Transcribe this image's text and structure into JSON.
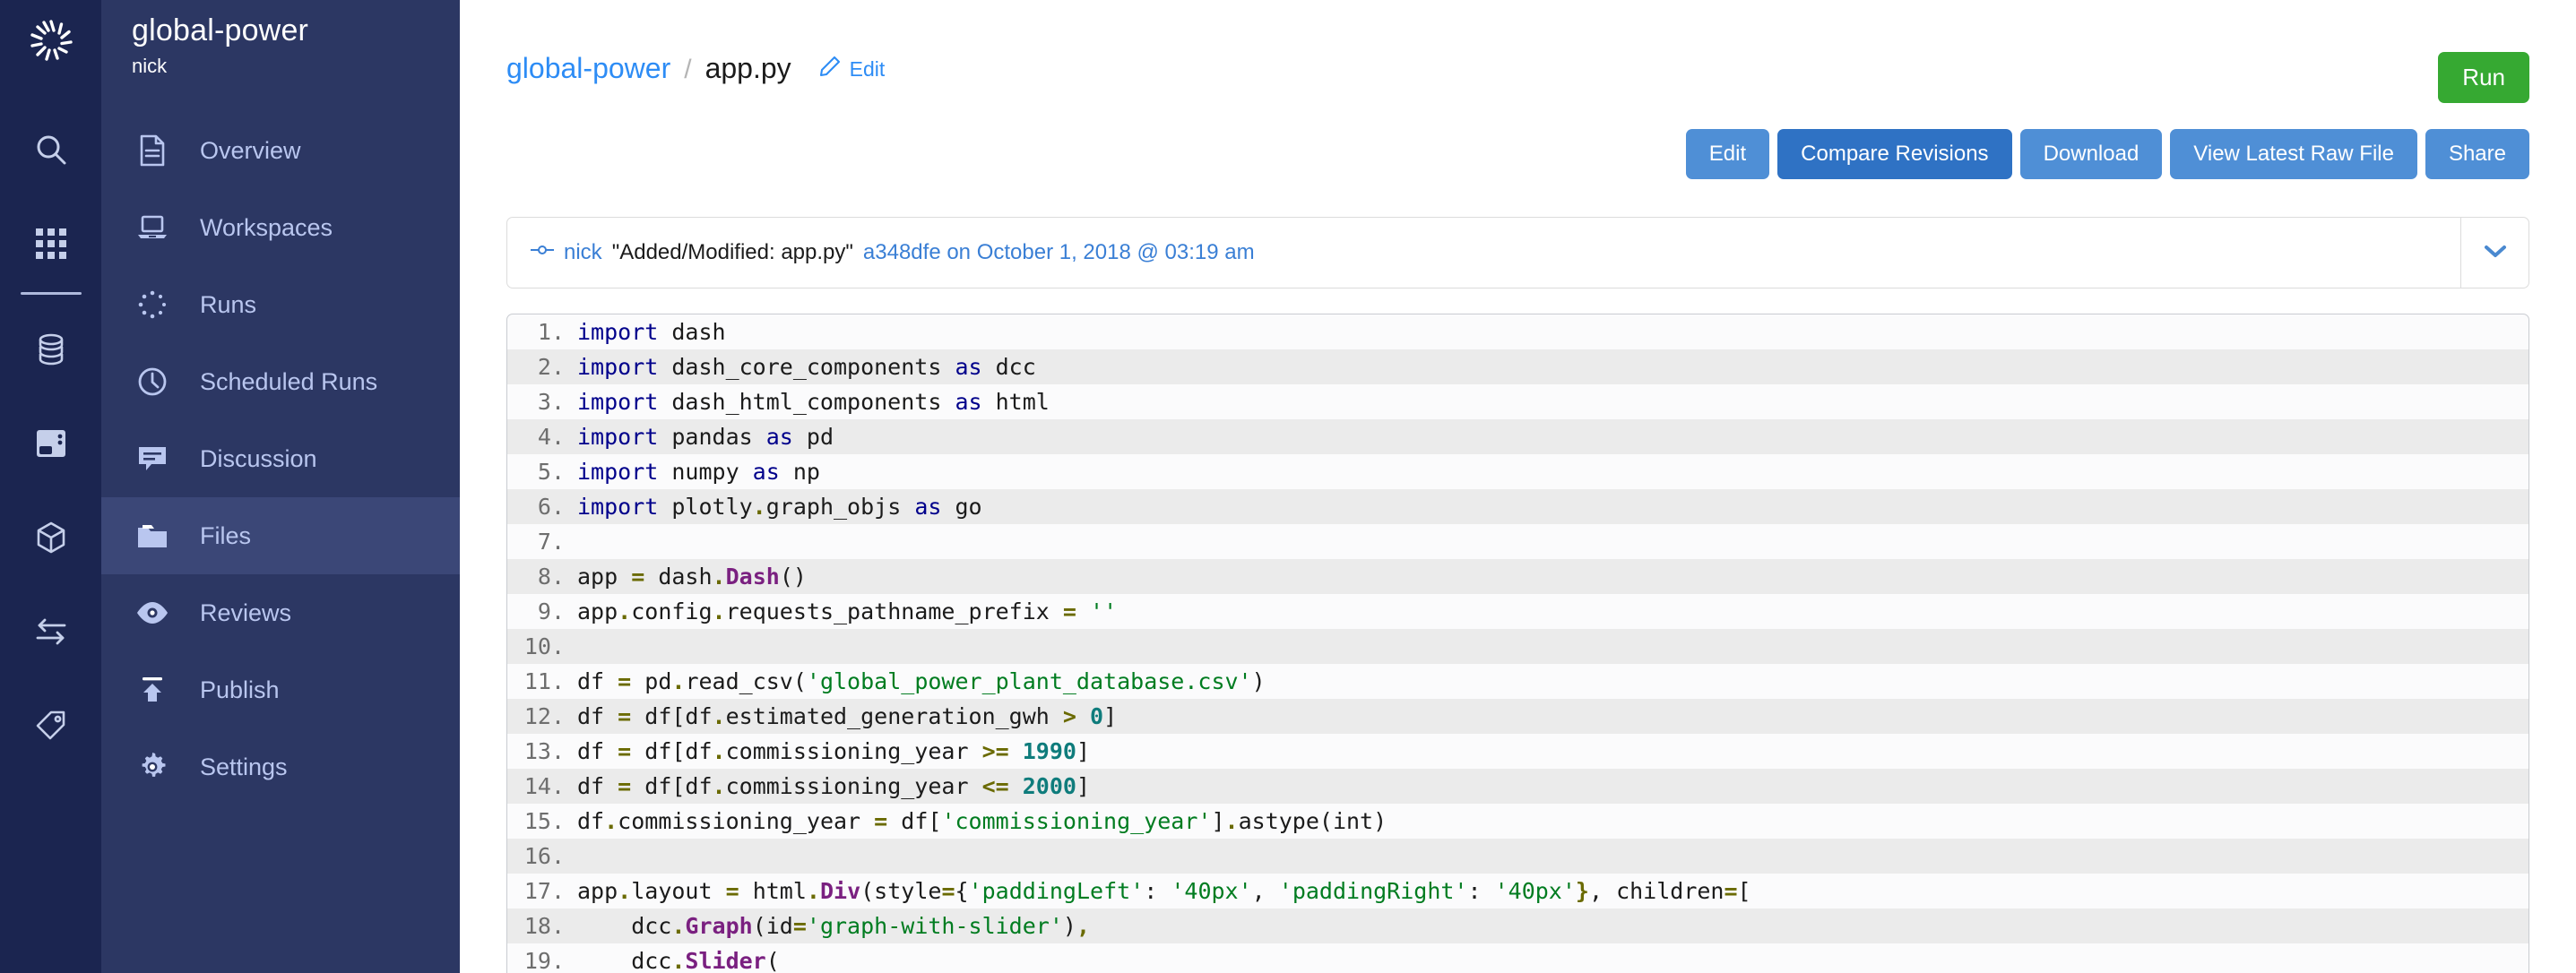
{
  "rail": {
    "logo_icon": "aperture-logo-icon",
    "icons": [
      {
        "name": "search-icon"
      },
      {
        "name": "apps-grid-icon"
      },
      {
        "name": "database-icon"
      },
      {
        "name": "server-icon"
      },
      {
        "name": "box-icon"
      },
      {
        "name": "transfer-arrows-icon"
      },
      {
        "name": "tag-icon"
      }
    ]
  },
  "sidebar": {
    "project": "global-power",
    "owner": "nick",
    "items": [
      {
        "label": "Overview",
        "icon": "document-icon",
        "active": false
      },
      {
        "label": "Workspaces",
        "icon": "laptop-icon",
        "active": false
      },
      {
        "label": "Runs",
        "icon": "spinner-dots-icon",
        "active": false
      },
      {
        "label": "Scheduled Runs",
        "icon": "clock-icon",
        "active": false
      },
      {
        "label": "Discussion",
        "icon": "comment-icon",
        "active": false
      },
      {
        "label": "Files",
        "icon": "folder-icon",
        "active": true
      },
      {
        "label": "Reviews",
        "icon": "eye-icon",
        "active": false
      },
      {
        "label": "Publish",
        "icon": "upload-arrow-icon",
        "active": false
      },
      {
        "label": "Settings",
        "icon": "gear-icon",
        "active": false
      }
    ]
  },
  "header": {
    "breadcrumb_root": "global-power",
    "breadcrumb_separator": "/",
    "breadcrumb_current": "app.py",
    "edit_label": "Edit",
    "edit_icon": "pencil-icon",
    "run_label": "Run"
  },
  "actions": [
    {
      "label": "Edit",
      "primary": false
    },
    {
      "label": "Compare Revisions",
      "primary": true
    },
    {
      "label": "Download",
      "primary": false
    },
    {
      "label": "View Latest Raw File",
      "primary": false
    },
    {
      "label": "Share",
      "primary": false
    }
  ],
  "commit": {
    "icon": "commit-node-icon",
    "user": "nick",
    "message": "\"Added/Modified: app.py\"",
    "hash_and_date": "a348dfe on October 1, 2018 @ 03:19 am",
    "caret_icon": "chevron-down-icon"
  },
  "code": {
    "language": "python",
    "lines": [
      {
        "n": "1.",
        "tokens": [
          [
            "kn",
            "import"
          ],
          [
            "p",
            " dash"
          ]
        ]
      },
      {
        "n": "2.",
        "tokens": [
          [
            "kn",
            "import"
          ],
          [
            "p",
            " dash_core_components "
          ],
          [
            "kn",
            "as"
          ],
          [
            "p",
            " dcc"
          ]
        ]
      },
      {
        "n": "3.",
        "tokens": [
          [
            "kn",
            "import"
          ],
          [
            "p",
            " dash_html_components "
          ],
          [
            "kn",
            "as"
          ],
          [
            "p",
            " html"
          ]
        ]
      },
      {
        "n": "4.",
        "tokens": [
          [
            "kn",
            "import"
          ],
          [
            "p",
            " pandas "
          ],
          [
            "kn",
            "as"
          ],
          [
            "p",
            " pd"
          ]
        ]
      },
      {
        "n": "5.",
        "tokens": [
          [
            "kn",
            "import"
          ],
          [
            "p",
            " numpy "
          ],
          [
            "kn",
            "as"
          ],
          [
            "p",
            " np"
          ]
        ]
      },
      {
        "n": "6.",
        "tokens": [
          [
            "kn",
            "import"
          ],
          [
            "p",
            " plotly"
          ],
          [
            "o",
            "."
          ],
          [
            "p",
            "graph_objs "
          ],
          [
            "kn",
            "as"
          ],
          [
            "p",
            " go"
          ]
        ]
      },
      {
        "n": "7.",
        "tokens": []
      },
      {
        "n": "8.",
        "tokens": [
          [
            "p",
            "app "
          ],
          [
            "o",
            "="
          ],
          [
            "p",
            " dash"
          ],
          [
            "o",
            "."
          ],
          [
            "cl",
            "Dash"
          ],
          [
            "p",
            "()"
          ]
        ]
      },
      {
        "n": "9.",
        "tokens": [
          [
            "p",
            "app"
          ],
          [
            "o",
            "."
          ],
          [
            "p",
            "config"
          ],
          [
            "o",
            "."
          ],
          [
            "p",
            "requests_pathname_prefix "
          ],
          [
            "o",
            "="
          ],
          [
            "p",
            " "
          ],
          [
            "s",
            "''"
          ]
        ]
      },
      {
        "n": "10.",
        "tokens": []
      },
      {
        "n": "11.",
        "tokens": [
          [
            "p",
            "df "
          ],
          [
            "o",
            "="
          ],
          [
            "p",
            " pd"
          ],
          [
            "o",
            "."
          ],
          [
            "p",
            "read_csv("
          ],
          [
            "s",
            "'global_power_plant_database.csv'"
          ],
          [
            "p",
            ")"
          ]
        ]
      },
      {
        "n": "12.",
        "tokens": [
          [
            "p",
            "df "
          ],
          [
            "o",
            "="
          ],
          [
            "p",
            " df[df"
          ],
          [
            "o",
            "."
          ],
          [
            "p",
            "estimated_generation_gwh "
          ],
          [
            "o",
            ">"
          ],
          [
            "p",
            " "
          ],
          [
            "n",
            "0"
          ],
          [
            "p",
            "]"
          ]
        ]
      },
      {
        "n": "13.",
        "tokens": [
          [
            "p",
            "df "
          ],
          [
            "o",
            "="
          ],
          [
            "p",
            " df[df"
          ],
          [
            "o",
            "."
          ],
          [
            "p",
            "commissioning_year "
          ],
          [
            "o",
            ">="
          ],
          [
            "p",
            " "
          ],
          [
            "n",
            "1990"
          ],
          [
            "p",
            "]"
          ]
        ]
      },
      {
        "n": "14.",
        "tokens": [
          [
            "p",
            "df "
          ],
          [
            "o",
            "="
          ],
          [
            "p",
            " df[df"
          ],
          [
            "o",
            "."
          ],
          [
            "p",
            "commissioning_year "
          ],
          [
            "o",
            "<="
          ],
          [
            "p",
            " "
          ],
          [
            "n",
            "2000"
          ],
          [
            "p",
            "]"
          ]
        ]
      },
      {
        "n": "15.",
        "tokens": [
          [
            "p",
            "df"
          ],
          [
            "o",
            "."
          ],
          [
            "p",
            "commissioning_year "
          ],
          [
            "o",
            "="
          ],
          [
            "p",
            " df["
          ],
          [
            "s",
            "'commissioning_year'"
          ],
          [
            "p",
            "]"
          ],
          [
            "o",
            "."
          ],
          [
            "p",
            "astype(int)"
          ]
        ]
      },
      {
        "n": "16.",
        "tokens": []
      },
      {
        "n": "17.",
        "tokens": [
          [
            "p",
            "app"
          ],
          [
            "o",
            "."
          ],
          [
            "p",
            "layout "
          ],
          [
            "o",
            "="
          ],
          [
            "p",
            " html"
          ],
          [
            "o",
            "."
          ],
          [
            "cl",
            "Div"
          ],
          [
            "p",
            "(style"
          ],
          [
            "o",
            "="
          ],
          [
            "p",
            "{"
          ],
          [
            "s",
            "'paddingLeft'"
          ],
          [
            "p",
            ": "
          ],
          [
            "s",
            "'40px'"
          ],
          [
            "p",
            ", "
          ],
          [
            "s",
            "'paddingRight'"
          ],
          [
            "p",
            ": "
          ],
          [
            "s",
            "'40px'"
          ],
          [
            "o",
            "}"
          ],
          [
            "p",
            ", children"
          ],
          [
            "o",
            "="
          ],
          [
            "p",
            "["
          ]
        ]
      },
      {
        "n": "18.",
        "tokens": [
          [
            "p",
            "    dcc"
          ],
          [
            "o",
            "."
          ],
          [
            "cl",
            "Graph"
          ],
          [
            "p",
            "(id"
          ],
          [
            "o",
            "="
          ],
          [
            "s",
            "'graph-with-slider'"
          ],
          [
            "p",
            ")"
          ],
          [
            "o",
            ","
          ]
        ]
      },
      {
        "n": "19.",
        "tokens": [
          [
            "p",
            "    dcc"
          ],
          [
            "o",
            "."
          ],
          [
            "cl",
            "Slider"
          ],
          [
            "p",
            "("
          ]
        ]
      }
    ]
  }
}
